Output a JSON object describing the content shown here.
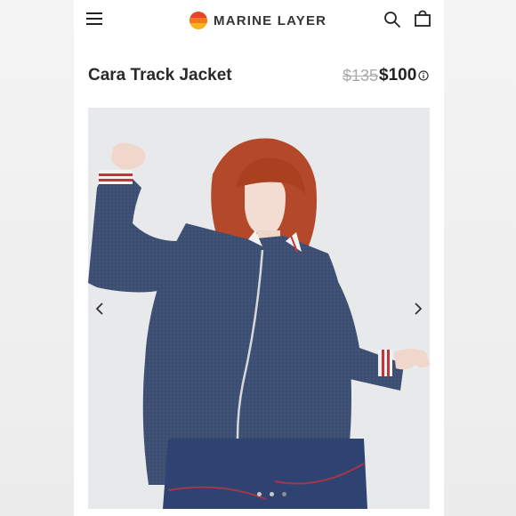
{
  "header": {
    "brand_name": "MARINE LAYER",
    "menu_icon": "hamburger-menu-icon",
    "search_icon": "search-icon",
    "bag_icon": "shopping-bag-icon",
    "logo_colors": [
      "#e8412c",
      "#f27a1d",
      "#f7b21d"
    ]
  },
  "product": {
    "title": "Cara Track Jacket",
    "original_price": "$135",
    "sale_price": "$100",
    "info_icon": "info-icon"
  },
  "gallery": {
    "prev_icon": "chevron-left-icon",
    "next_icon": "chevron-right-icon",
    "slide_count": 3,
    "active_slide": 3,
    "jacket_color": "#3d4f72",
    "hair_color": "#b4482a"
  }
}
